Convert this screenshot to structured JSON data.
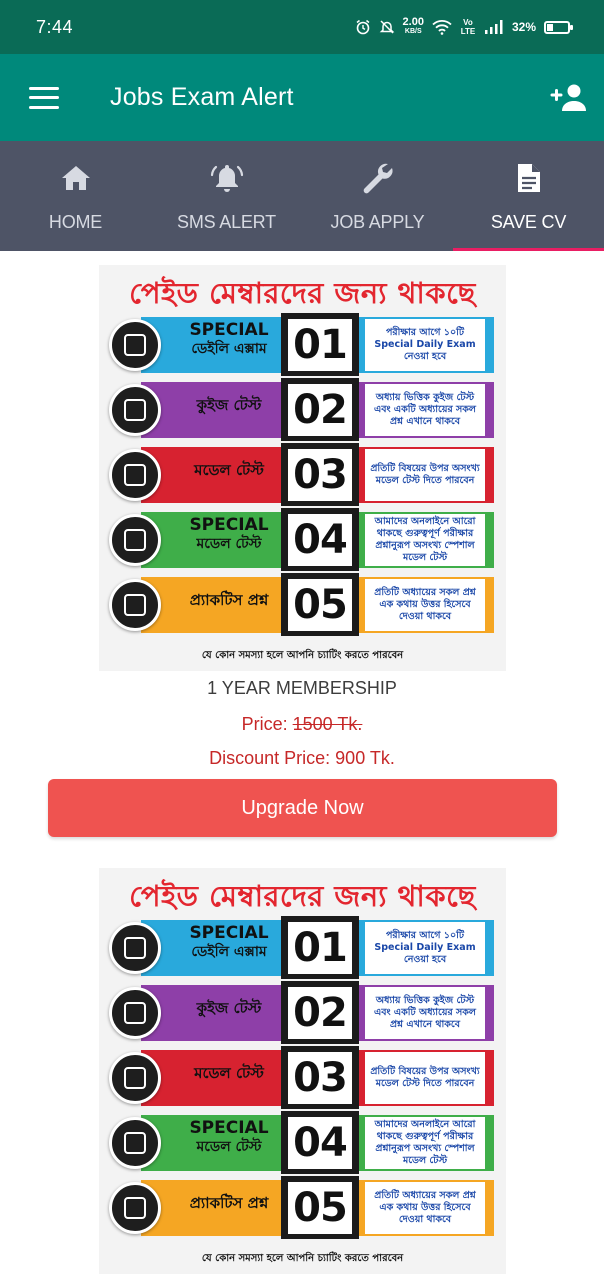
{
  "status_bar": {
    "time": "7:44",
    "speed_value": "2.00",
    "speed_unit": "KB/S",
    "network": "Vo LTE",
    "battery_percent": "32%",
    "battery_level": 0.32
  },
  "app_bar": {
    "title": "Jobs Exam Alert",
    "menu_icon": "hamburger-menu-icon",
    "action_icon": "add-user-icon"
  },
  "tabs": [
    {
      "label": "HOME",
      "icon": "home-icon",
      "active": false
    },
    {
      "label": "SMS ALERT",
      "icon": "bell-icon",
      "active": false
    },
    {
      "label": "JOB APPLY",
      "icon": "wrench-icon",
      "active": false
    },
    {
      "label": "SAVE CV",
      "icon": "document-icon",
      "active": true
    }
  ],
  "colors": {
    "status_bar": "#0a6b56",
    "app_bar": "#00897b",
    "tab_bar": "#4e5466",
    "tab_indicator": "#e91e63",
    "price_text": "#c62828",
    "upgrade_button": "#ef5350"
  },
  "promo": {
    "headline": "পেইড মেম্বারদের জন্য থাকছে",
    "footer": "যে কোন সমস্যা হলে আপনি চ্যাটিং করতে পারবেন",
    "rows": [
      {
        "number": "01",
        "title_line1": "SPECIAL",
        "title_line2": "ডেইলি এক্সাম",
        "description": "পরীক্ষার আগে ১০টি Special Daily Exam নেওয়া হবে",
        "color": "#29a9dc"
      },
      {
        "number": "02",
        "title_line1": "",
        "title_line2": "কুইজ টেস্ট",
        "description": "অধ্যায় ভিত্তিক কুইজ টেস্ট এবং একটি অধ্যায়ের সকল প্রশ্ন এখানে থাকবে",
        "color": "#8e3fa8"
      },
      {
        "number": "03",
        "title_line1": "",
        "title_line2": "মডেল টেস্ট",
        "description": "প্রতিটি বিষয়ের উপর অসংখ্য মডেল টেস্ট দিতে পারবেন",
        "color": "#d72230"
      },
      {
        "number": "04",
        "title_line1": "SPECIAL",
        "title_line2": "মডেল টেস্ট",
        "description": "আমাদের অনলাইনে আরো থাকছে গুরুত্বপূর্ণ পরীক্ষার প্রশ্নানুরূপ অসংখ্য স্পেশাল মডেল টেস্ট",
        "color": "#3fae49"
      },
      {
        "number": "05",
        "title_line1": "",
        "title_line2": "প্র্যাকটিস প্রশ্ন",
        "description": "প্রতিটি অধ্যায়ের সকল প্রশ্ন এক কথায় উত্তর হিসেবে দেওয়া থাকবে",
        "color": "#f5a623"
      }
    ]
  },
  "plan": {
    "title": "1 YEAR MEMBERSHIP",
    "price_label": "Price: ",
    "original_price": "1500 Tk.",
    "discount_label": "Discount Price: 900 Tk.",
    "button_label": "Upgrade Now"
  }
}
